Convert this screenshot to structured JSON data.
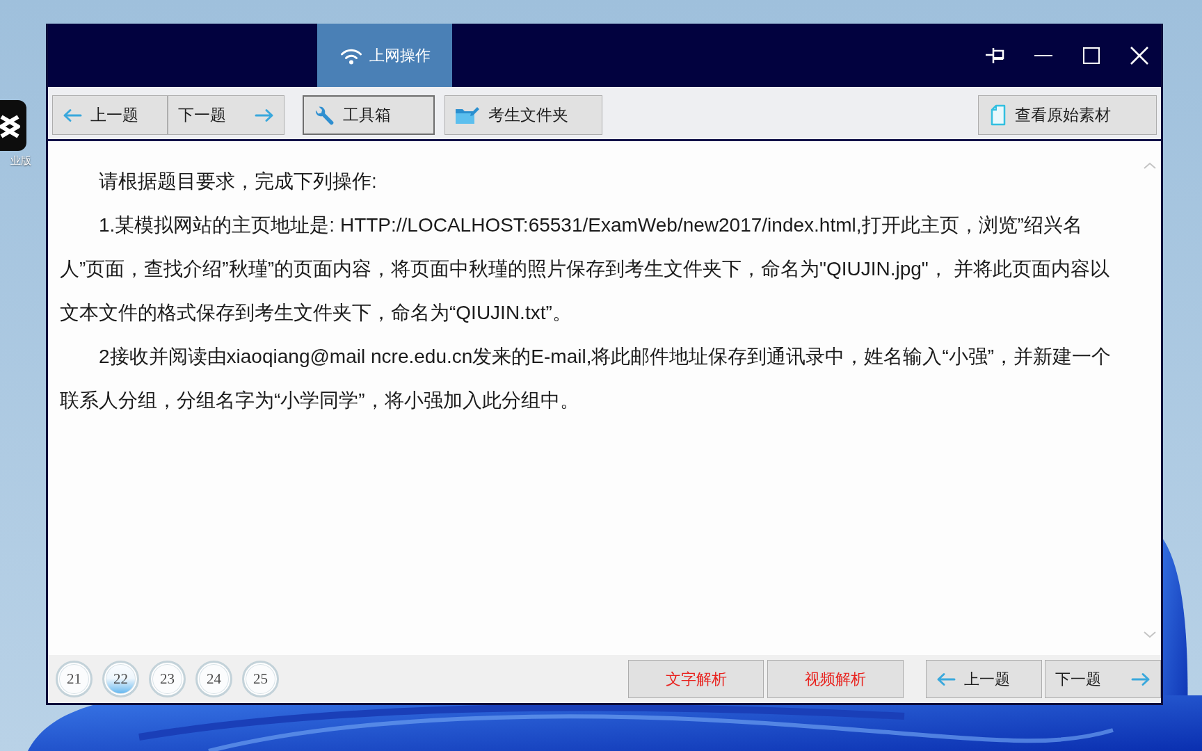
{
  "desktop": {
    "icons": [
      {
        "label": "业版"
      }
    ]
  },
  "window": {
    "tabs": [
      {
        "label": "上网操作",
        "selected": true
      }
    ],
    "toolbar": {
      "nav": [
        {
          "kind": "prev",
          "label": "上一题"
        },
        {
          "kind": "next",
          "label": "下一题"
        }
      ],
      "buttons": [
        {
          "kind": "tools",
          "label": "工具箱",
          "focused": true
        },
        {
          "kind": "folder",
          "label": "考生文件夹",
          "focused": false
        }
      ],
      "material_button": {
        "label": "查看原始素材"
      }
    },
    "question": {
      "paragraphs": [
        "请根据题目要求，完成下列操作:",
        "1.某模拟网站的主页地址是: HTTP://LOCALHOST:65531/ExamWeb/new2017/index.html,打开此主页，浏览”绍兴名人”页面，查找介绍”秋瑾”的页面内容，将页面中秋瑾的照片保存到考生文件夹下，命名为\"QIUJIN.jpg\"， 并将此页面内容以文本文件的格式保存到考生文件夹下，命名为“QIUJIN.txt”。",
        "2接收并阅读由xiaoqiang@mail ncre.edu.cn发来的E-mail,将此邮件地址保存到通讯录中，姓名输入“小强”，并新建一个联系人分组，分组名字为“小学同学”，将小强加入此分组中。"
      ]
    },
    "footer": {
      "pages": [
        {
          "label": "21",
          "selected": false
        },
        {
          "label": "22",
          "selected": true
        },
        {
          "label": "23",
          "selected": false
        },
        {
          "label": "24",
          "selected": false
        },
        {
          "label": "25",
          "selected": false
        }
      ],
      "analysis_buttons": [
        {
          "label": "文字解析"
        },
        {
          "label": "视频解析"
        }
      ],
      "nav": [
        {
          "kind": "prev",
          "label": "上一题"
        },
        {
          "kind": "next",
          "label": "下一题"
        }
      ]
    }
  }
}
